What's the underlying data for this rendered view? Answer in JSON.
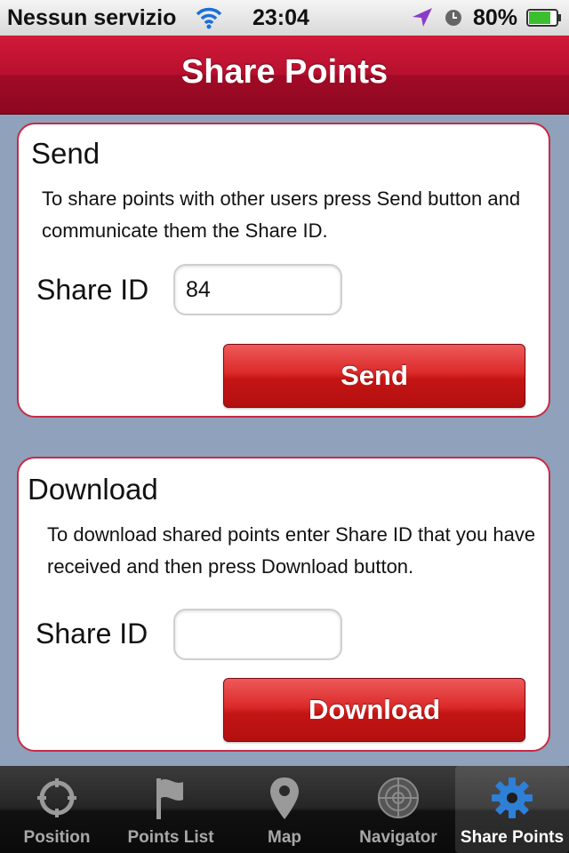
{
  "status_bar": {
    "carrier": "Nessun servizio",
    "time": "23:04",
    "battery_percent": "80%"
  },
  "nav": {
    "title": "Share Points"
  },
  "send_panel": {
    "title": "Send",
    "description": "To share points with other users press Send button and communicate them the Share ID.",
    "share_id_label": "Share ID",
    "share_id_value": "84",
    "button_label": "Send"
  },
  "download_panel": {
    "title": "Download",
    "description": "To download shared points enter Share ID that you have received and then press Download button.",
    "share_id_label": "Share ID",
    "share_id_value": "",
    "button_label": "Download"
  },
  "tabs": [
    {
      "label": "Position",
      "icon": "crosshair-icon"
    },
    {
      "label": "Points List",
      "icon": "flag-icon"
    },
    {
      "label": "Map",
      "icon": "map-pin-icon"
    },
    {
      "label": "Navigator",
      "icon": "radar-icon"
    },
    {
      "label": "Share Points",
      "icon": "gear-icon",
      "active": true
    }
  ],
  "colors": {
    "accent": "#b80f2e",
    "button": "#c41515",
    "background": "#8fa1bb",
    "active_tab_icon": "#2e7fd6"
  }
}
